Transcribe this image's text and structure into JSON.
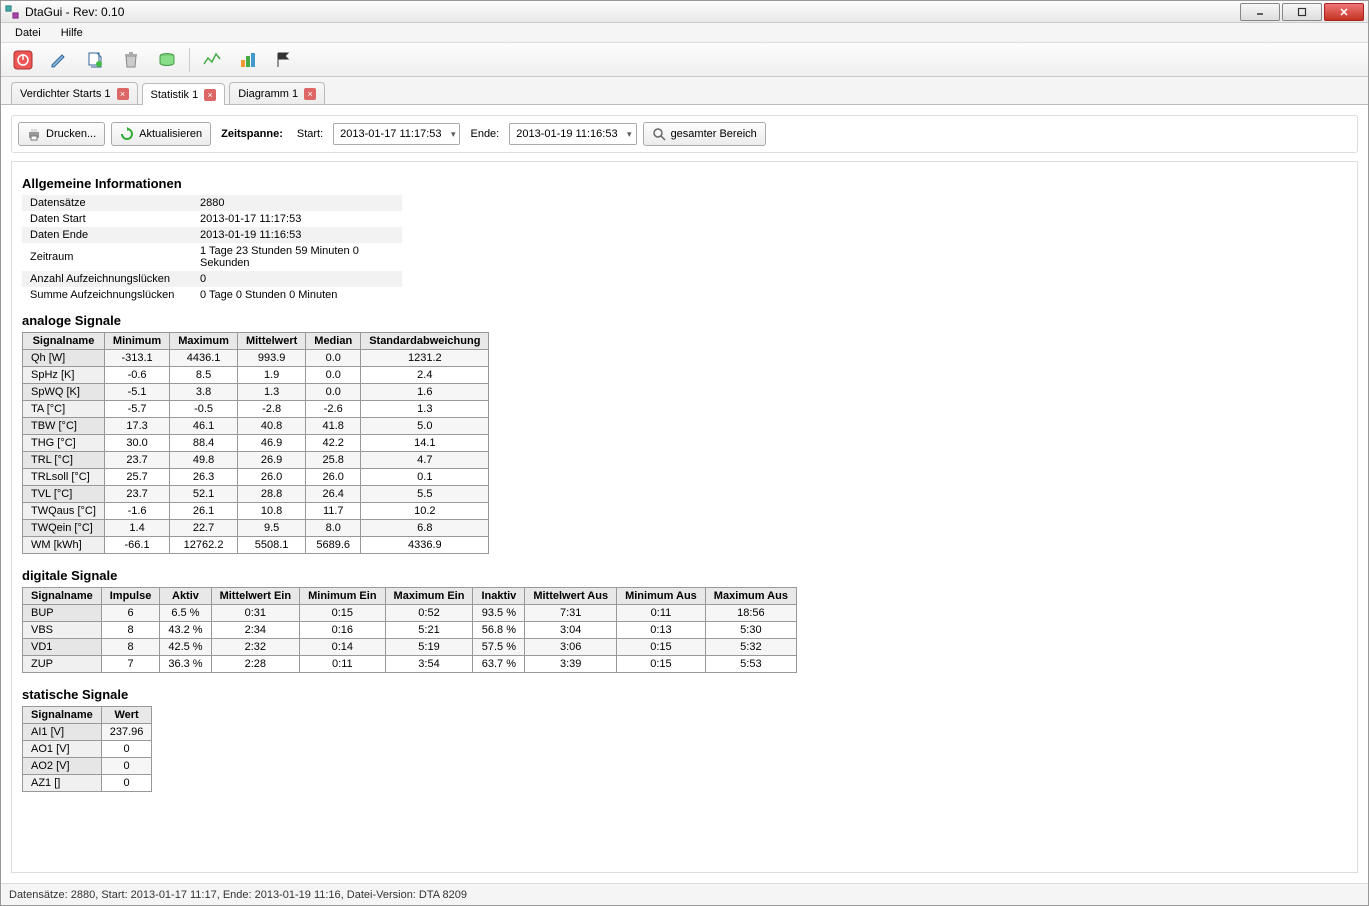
{
  "window": {
    "title": "DtaGui - Rev: 0.10"
  },
  "menus": {
    "file": "Datei",
    "help": "Hilfe"
  },
  "tabs": [
    {
      "label": "Verdichter Starts 1",
      "active": false
    },
    {
      "label": "Statistik 1",
      "active": true
    },
    {
      "label": "Diagramm 1",
      "active": false
    }
  ],
  "actions": {
    "print": "Drucken...",
    "refresh": "Aktualisieren",
    "timespan_label": "Zeitspanne:",
    "start_label": "Start:",
    "start_value": "2013-01-17 11:17:53",
    "end_label": "Ende:",
    "end_value": "2013-01-19 11:16:53",
    "full_range": "gesamter Bereich"
  },
  "sections": {
    "general": "Allgemeine Informationen",
    "analog": "analoge Signale",
    "digital": "digitale Signale",
    "static": "statische Signale"
  },
  "general_info": [
    {
      "k": "Datensätze",
      "v": "2880"
    },
    {
      "k": "Daten Start",
      "v": "2013-01-17 11:17:53"
    },
    {
      "k": "Daten Ende",
      "v": "2013-01-19 11:16:53"
    },
    {
      "k": "Zeitraum",
      "v": "1 Tage 23 Stunden 59 Minuten 0 Sekunden"
    },
    {
      "k": "Anzahl Aufzeichnungslücken",
      "v": "0"
    },
    {
      "k": "Summe Aufzeichnungslücken",
      "v": "0 Tage 0 Stunden 0 Minuten"
    }
  ],
  "analog_headers": [
    "Signalname",
    "Minimum",
    "Maximum",
    "Mittelwert",
    "Median",
    "Standardabweichung"
  ],
  "analog_rows": [
    [
      "Qh [W]",
      "-313.1",
      "4436.1",
      "993.9",
      "0.0",
      "1231.2"
    ],
    [
      "SpHz [K]",
      "-0.6",
      "8.5",
      "1.9",
      "0.0",
      "2.4"
    ],
    [
      "SpWQ [K]",
      "-5.1",
      "3.8",
      "1.3",
      "0.0",
      "1.6"
    ],
    [
      "TA [°C]",
      "-5.7",
      "-0.5",
      "-2.8",
      "-2.6",
      "1.3"
    ],
    [
      "TBW [°C]",
      "17.3",
      "46.1",
      "40.8",
      "41.8",
      "5.0"
    ],
    [
      "THG [°C]",
      "30.0",
      "88.4",
      "46.9",
      "42.2",
      "14.1"
    ],
    [
      "TRL [°C]",
      "23.7",
      "49.8",
      "26.9",
      "25.8",
      "4.7"
    ],
    [
      "TRLsoll [°C]",
      "25.7",
      "26.3",
      "26.0",
      "26.0",
      "0.1"
    ],
    [
      "TVL [°C]",
      "23.7",
      "52.1",
      "28.8",
      "26.4",
      "5.5"
    ],
    [
      "TWQaus [°C]",
      "-1.6",
      "26.1",
      "10.8",
      "11.7",
      "10.2"
    ],
    [
      "TWQein [°C]",
      "1.4",
      "22.7",
      "9.5",
      "8.0",
      "6.8"
    ],
    [
      "WM [kWh]",
      "-66.1",
      "12762.2",
      "5508.1",
      "5689.6",
      "4336.9"
    ]
  ],
  "digital_headers": [
    "Signalname",
    "Impulse",
    "Aktiv",
    "Mittelwert Ein",
    "Minimum Ein",
    "Maximum Ein",
    "Inaktiv",
    "Mittelwert Aus",
    "Minimum Aus",
    "Maximum Aus"
  ],
  "digital_rows": [
    [
      "BUP",
      "6",
      "6.5 %",
      "0:31",
      "0:15",
      "0:52",
      "93.5 %",
      "7:31",
      "0:11",
      "18:56"
    ],
    [
      "VBS",
      "8",
      "43.2 %",
      "2:34",
      "0:16",
      "5:21",
      "56.8 %",
      "3:04",
      "0:13",
      "5:30"
    ],
    [
      "VD1",
      "8",
      "42.5 %",
      "2:32",
      "0:14",
      "5:19",
      "57.5 %",
      "3:06",
      "0:15",
      "5:32"
    ],
    [
      "ZUP",
      "7",
      "36.3 %",
      "2:28",
      "0:11",
      "3:54",
      "63.7 %",
      "3:39",
      "0:15",
      "5:53"
    ]
  ],
  "static_headers": [
    "Signalname",
    "Wert"
  ],
  "static_rows": [
    [
      "AI1 [V]",
      "237.96"
    ],
    [
      "AO1 [V]",
      "0"
    ],
    [
      "AO2 [V]",
      "0"
    ],
    [
      "AZ1 []",
      "0"
    ]
  ],
  "statusbar": "Datensätze: 2880, Start: 2013-01-17 11:17, Ende: 2013-01-19 11:16, Datei-Version: DTA 8209"
}
